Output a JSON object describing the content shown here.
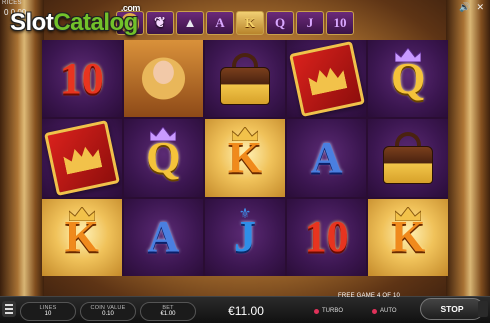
{
  "watermark": {
    "slot": "Slot",
    "catalog": "Catalog",
    "com": ".com"
  },
  "top": {
    "tiny_left": "RICES",
    "tiny_left2": "0 0.00",
    "icons": [
      "sound-icon",
      "close-icon"
    ]
  },
  "paytable": [
    {
      "label": "",
      "kind": "lady"
    },
    {
      "label": "",
      "kind": "bow"
    },
    {
      "label": "",
      "kind": "shoe"
    },
    {
      "label": "A",
      "kind": "p"
    },
    {
      "label": "K",
      "kind": "g",
      "active": true
    },
    {
      "label": "Q",
      "kind": "p"
    },
    {
      "label": "J",
      "kind": "p"
    },
    {
      "label": "10",
      "kind": "p"
    }
  ],
  "reels": [
    [
      "10",
      "book",
      "K"
    ],
    [
      "lady",
      "Q",
      "A"
    ],
    [
      "bag",
      "K",
      "J"
    ],
    [
      "book",
      "A",
      "10"
    ],
    [
      "Q",
      "bag",
      "K"
    ]
  ],
  "controls": {
    "lines_label": "LINES",
    "lines_value": "10",
    "coin_label": "COIN VALUE",
    "coin_value": "0.10",
    "bet_label": "BET",
    "bet_value": "€1.00",
    "balance": "€11.00",
    "free_game": "FREE GAME 4 OF 10",
    "turbo": "TURBO",
    "auto": "AUTO",
    "stop": "STOP"
  },
  "colors": {
    "reel_bg": "#3b1650",
    "gold": "#f0c25a",
    "accent_red": "#e0325a"
  }
}
